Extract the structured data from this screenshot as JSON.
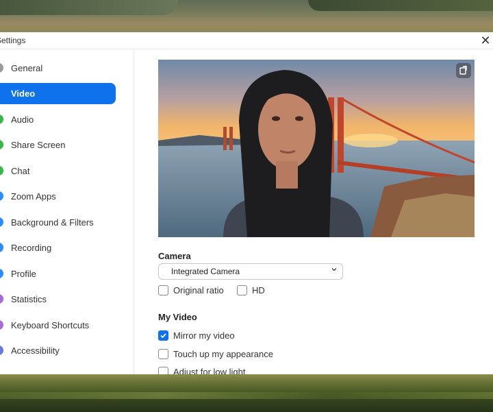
{
  "window": {
    "title": "Settings"
  },
  "close_glyph": "✕",
  "colors": {
    "accent": "#0e72ed"
  },
  "sidebar": {
    "items": [
      {
        "label": "General",
        "icon": "gear-icon",
        "color": "#9a9a9a"
      },
      {
        "label": "Video",
        "icon": "video-icon",
        "color": "#ffffff",
        "active": true
      },
      {
        "label": "Audio",
        "icon": "headphones-icon",
        "color": "#3ab54a"
      },
      {
        "label": "Share Screen",
        "icon": "share-screen-icon",
        "color": "#3ab54a"
      },
      {
        "label": "Chat",
        "icon": "chat-icon",
        "color": "#3ab54a"
      },
      {
        "label": "Zoom Apps",
        "icon": "apps-icon",
        "color": "#2d8cff"
      },
      {
        "label": "Background & Filters",
        "icon": "background-icon",
        "color": "#2d8cff"
      },
      {
        "label": "Recording",
        "icon": "record-icon",
        "color": "#2d8cff"
      },
      {
        "label": "Profile",
        "icon": "profile-icon",
        "color": "#2d8cff"
      },
      {
        "label": "Statistics",
        "icon": "statistics-icon",
        "color": "#a86cd9"
      },
      {
        "label": "Keyboard Shortcuts",
        "icon": "keyboard-icon",
        "color": "#a86cd9"
      },
      {
        "label": "Accessibility",
        "icon": "accessibility-icon",
        "color": "#6a79d8"
      }
    ]
  },
  "video": {
    "camera_heading": "Camera",
    "camera_value": "Integrated Camera",
    "options": [
      {
        "label": "Original ratio",
        "checked": false
      },
      {
        "label": "HD",
        "checked": false
      }
    ],
    "my_video_heading": "My Video",
    "my_video_options": [
      {
        "label": "Mirror my video",
        "checked": true
      },
      {
        "label": "Touch up my appearance",
        "checked": false
      },
      {
        "label": "Adjust for low light",
        "checked": false
      }
    ]
  }
}
